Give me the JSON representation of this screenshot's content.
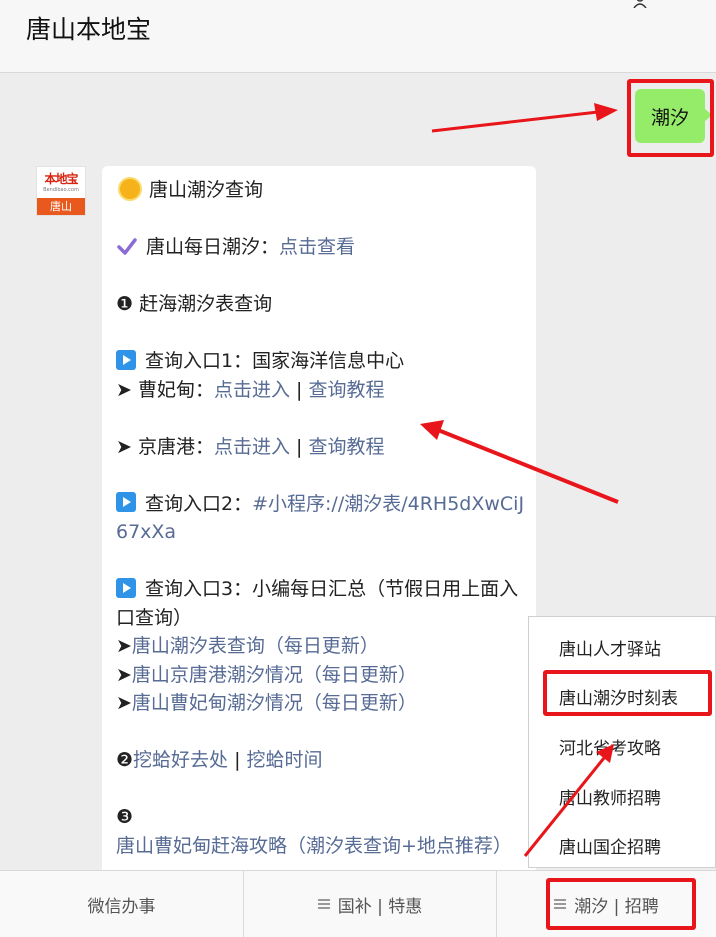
{
  "header": {
    "title": "唐山本地宝"
  },
  "user_message": {
    "text": "潮汐"
  },
  "bot": {
    "avatar": {
      "brand_top": "本地宝",
      "brand_url": "Bendibao.com",
      "brand_bottom": "唐山"
    },
    "lines": {
      "title": "唐山潮汐查询",
      "daily_label": "唐山每日潮汐：",
      "daily_link": "点击查看",
      "sec1_num": "❶",
      "sec1_title": "赶海潮汐表查询",
      "entry1_label": "查询入口1：国家海洋信息中心",
      "arrow": "➤",
      "caofei_label": " 曹妃甸：",
      "enter_link": "点击进入",
      "sep": " | ",
      "tutorial_link": "查询教程",
      "jingtang_label": " 京唐港：",
      "entry2_label": "查询入口2：",
      "entry2_link": "#小程序://潮汐表/4RH5dXwCiJ67xXa",
      "entry3_label": "查询入口3：小编每日汇总（节假日用上面入口查询）",
      "daily1": "唐山潮汐表查询（每日更新）",
      "daily2": "唐山京唐港潮汐情况（每日更新）",
      "daily3": "唐山曹妃甸潮汐情况（每日更新）",
      "sec2_num": "❷",
      "sec2_link1": "挖蛤好去处",
      "sec2_link2": "挖蛤时间",
      "sec3_num": "❸",
      "sec3_link": "唐山曹妃甸赶海攻略（潮汐表查询+地点推荐）"
    }
  },
  "popup_menu": {
    "items": [
      "唐山人才驿站",
      "唐山潮汐时刻表",
      "河北省考攻略",
      "唐山教师招聘",
      "唐山国企招聘"
    ]
  },
  "bottom_bar": {
    "tabs": [
      {
        "label": "微信办事",
        "has_menu_icon": false
      },
      {
        "label": "国补 | 特惠",
        "has_menu_icon": true
      },
      {
        "label": "潮汐 | 招聘",
        "has_menu_icon": true
      }
    ]
  },
  "colors": {
    "link": "#576b95",
    "user_bubble": "#95ec69",
    "highlight": "#e8161a",
    "background": "#ededed"
  }
}
